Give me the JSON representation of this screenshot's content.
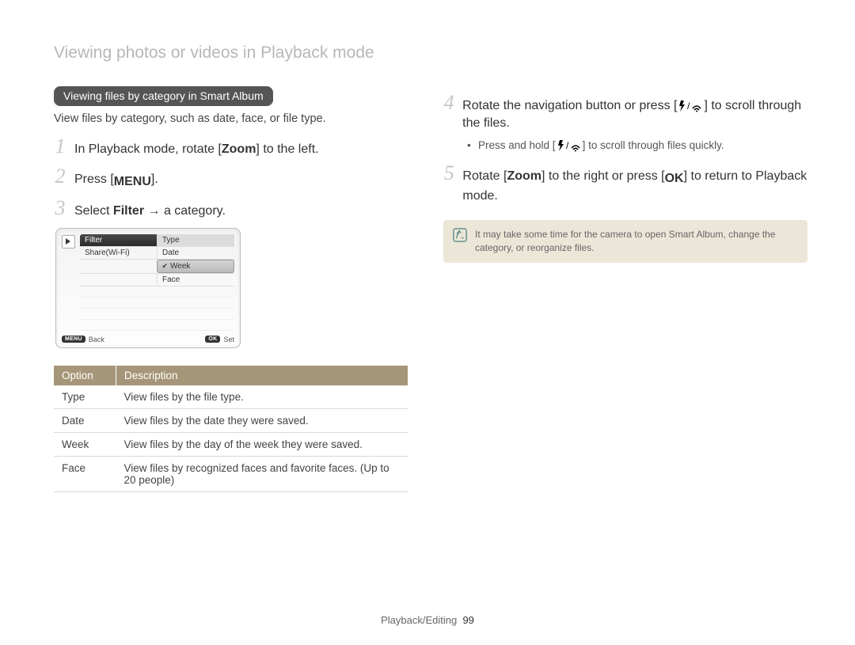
{
  "page_title": "Viewing photos or videos in Playback mode",
  "section_title": "Viewing files by category in Smart Album",
  "intro": "View files by category, such as date, face, or file type.",
  "steps_left": [
    {
      "num": "1",
      "pre": "In Playback mode, rotate [",
      "bold": "Zoom",
      "post": "] to the left."
    },
    {
      "num": "2",
      "pre": "Press [",
      "icon": "MENU",
      "post": "]."
    },
    {
      "num": "3",
      "pre": "Select ",
      "bold": "Filter",
      "post": " → a category."
    }
  ],
  "screen": {
    "filter_label": "Filter",
    "filter_value": "Type",
    "share_label": "Share(Wi-Fi)",
    "options": [
      "Date",
      "Week",
      "Face"
    ],
    "selected_index": 1,
    "back_label": "Back",
    "set_label": "Set",
    "menu_btn": "MENU",
    "ok_btn": "OK"
  },
  "table": {
    "headers": {
      "option": "Option",
      "description": "Description"
    },
    "rows": [
      {
        "option": "Type",
        "desc": "View files by the file type."
      },
      {
        "option": "Date",
        "desc": "View files by the date they were saved."
      },
      {
        "option": "Week",
        "desc": "View files by the day of the week they were saved."
      },
      {
        "option": "Face",
        "desc": "View files by recognized faces and favorite faces. (Up to 20 people)"
      }
    ]
  },
  "steps_right": [
    {
      "num": "4",
      "text_before": "Rotate the navigation button or press [",
      "icons": "flash_wifi",
      "text_after": "] to scroll through the files."
    },
    {
      "num": "5",
      "pre": "Rotate [",
      "bold": "Zoom",
      "mid": "] to the right or press [",
      "icon": "OK",
      "post": "] to return to Playback mode."
    }
  ],
  "sub_bullet": {
    "before": "Press and hold [",
    "after": "] to scroll through files quickly."
  },
  "note": "It may take some time for the camera to open Smart Album, change the category, or reorganize files.",
  "footer": {
    "section": "Playback/Editing",
    "page": "99"
  }
}
